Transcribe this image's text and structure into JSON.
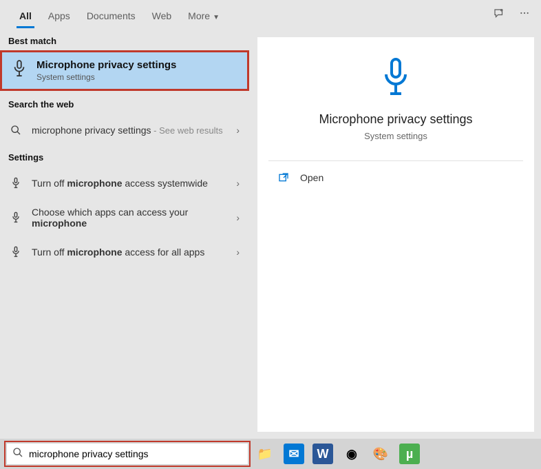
{
  "tabs": {
    "items": [
      "All",
      "Apps",
      "Documents",
      "Web",
      "More"
    ],
    "active_index": 0
  },
  "sections": {
    "best_match": "Best match",
    "search_web": "Search the web",
    "settings": "Settings"
  },
  "best_match_item": {
    "title": "Microphone privacy settings",
    "subtitle": "System settings"
  },
  "web_result": {
    "query": "microphone privacy settings",
    "suffix": " - See web results"
  },
  "settings_results": [
    {
      "pre": "Turn off ",
      "bold": "microphone",
      "post": " access systemwide"
    },
    {
      "pre": "Choose which apps can access your ",
      "bold": "microphone",
      "post": ""
    },
    {
      "pre": "Turn off ",
      "bold": "microphone",
      "post": " access for all apps"
    }
  ],
  "preview": {
    "title": "Microphone privacy settings",
    "subtitle": "System settings",
    "open_label": "Open"
  },
  "search_input": {
    "value": "microphone privacy settings"
  },
  "taskbar_icons": [
    {
      "name": "file-explorer-icon",
      "glyph": "📁"
    },
    {
      "name": "mail-icon",
      "glyph": "✉",
      "bg": "#0278d4",
      "color": "#fff"
    },
    {
      "name": "word-icon",
      "glyph": "W",
      "bg": "#2b5797",
      "color": "#fff"
    },
    {
      "name": "chrome-icon",
      "glyph": "◉"
    },
    {
      "name": "paint-icon",
      "glyph": "🎨"
    },
    {
      "name": "utorrent-icon",
      "glyph": "µ",
      "bg": "#4caf50",
      "color": "#fff"
    }
  ]
}
